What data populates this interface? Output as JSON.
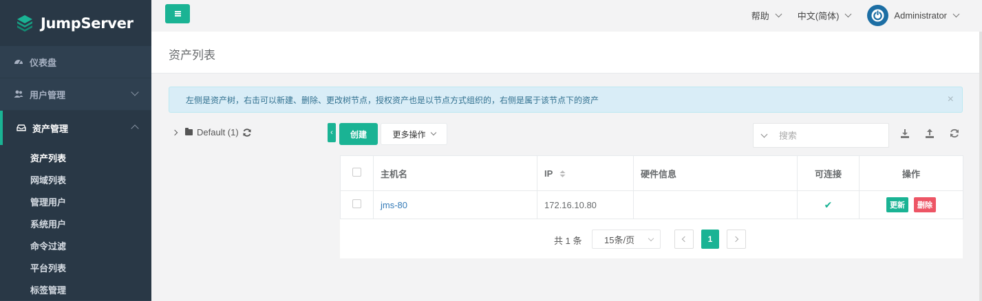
{
  "brand": {
    "name": "JumpServer",
    "accent": "#1ab394",
    "sidebar_bg": "#2f4050"
  },
  "topbar": {
    "help_label": "帮助",
    "language_label": "中文(简体)",
    "user_name": "Administrator"
  },
  "sidebar": {
    "items": [
      {
        "label": "仪表盘",
        "icon": "dashboard-icon"
      },
      {
        "label": "用户管理",
        "icon": "users-icon"
      },
      {
        "label": "资产管理",
        "icon": "inbox-icon"
      }
    ],
    "subitems": [
      {
        "label": "资产列表"
      },
      {
        "label": "网域列表"
      },
      {
        "label": "管理用户"
      },
      {
        "label": "系统用户"
      },
      {
        "label": "命令过滤"
      },
      {
        "label": "平台列表"
      },
      {
        "label": "标签管理"
      }
    ]
  },
  "page": {
    "title": "资产列表"
  },
  "alert": {
    "text": "左侧是资产树，右击可以新建、删除、更改树节点，授权资产也是以节点方式组织的，右侧是属于该节点下的资产",
    "close": "×"
  },
  "tree": {
    "root_label": "Default (1)"
  },
  "toolbar": {
    "collapse_glyph": "‹",
    "create_label": "创建",
    "more_label": "更多操作",
    "search_placeholder": "搜索"
  },
  "table": {
    "columns": [
      "主机名",
      "IP",
      "硬件信息",
      "可连接",
      "操作"
    ],
    "rows": [
      {
        "hostname": "jms-80",
        "ip": "172.16.10.80",
        "hardware": "",
        "connectable": "✔",
        "update_label": "更新",
        "delete_label": "删除"
      }
    ]
  },
  "pagination": {
    "total": "共 1 条",
    "page_size": "15条/页",
    "current_page": "1"
  }
}
